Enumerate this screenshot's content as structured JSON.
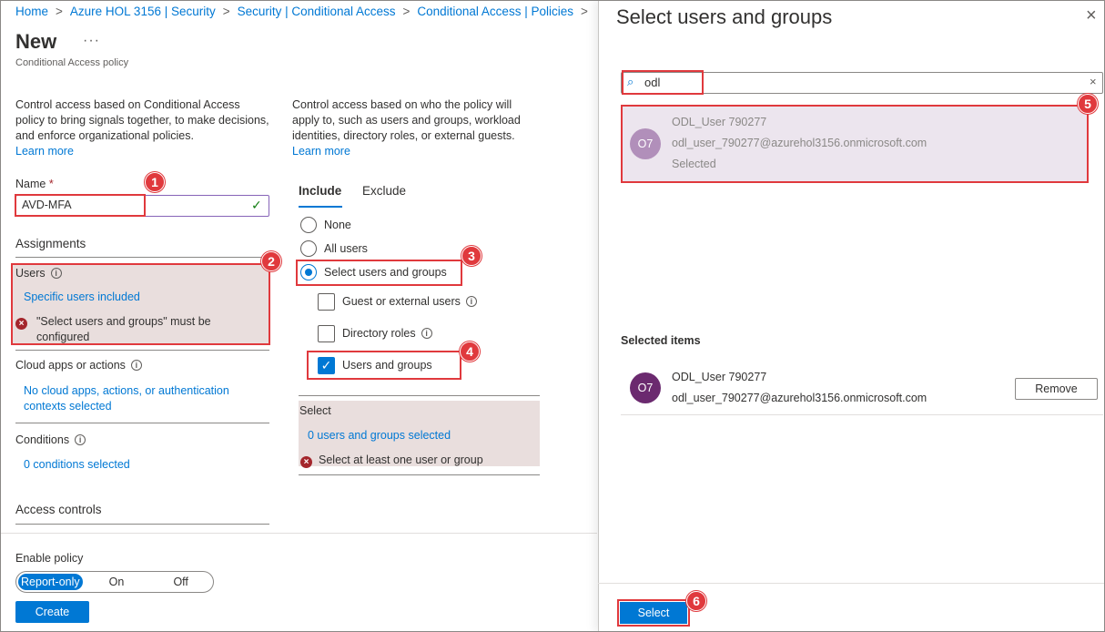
{
  "breadcrumb": [
    "Home",
    "Azure HOL 3156 | Security",
    "Security | Conditional Access",
    "Conditional Access | Policies"
  ],
  "page": {
    "title": "New",
    "more": "···",
    "subtitle": "Conditional Access policy"
  },
  "left_desc": {
    "text": "Control access based on Conditional Access policy to bring signals together, to make decisions, and enforce organizational policies.",
    "learn_more": "Learn more"
  },
  "name_field": {
    "label": "Name",
    "required_mark": "*",
    "value": "AVD-MFA"
  },
  "assignments": {
    "heading": "Assignments",
    "users": {
      "label": "Users",
      "value": "Specific users included",
      "error": "\"Select users and groups\" must be configured"
    },
    "cloud_apps": {
      "label": "Cloud apps or actions",
      "value": "No cloud apps, actions, or authentication contexts selected"
    },
    "conditions": {
      "label": "Conditions",
      "value": "0 conditions selected"
    }
  },
  "access_controls": {
    "heading": "Access controls"
  },
  "enable_policy": {
    "label": "Enable policy",
    "options": [
      "Report-only",
      "On",
      "Off"
    ],
    "selected": "Report-only"
  },
  "create_label": "Create",
  "mid_desc": {
    "text": "Control access based on who the policy will apply to, such as users and groups, workload identities, directory roles, or external guests.",
    "learn_more": "Learn more"
  },
  "tabs": [
    "Include",
    "Exclude"
  ],
  "include_options": {
    "none": "None",
    "all_users": "All users",
    "select_users": "Select users and groups",
    "guest": "Guest or external users",
    "directory_roles": "Directory roles",
    "users_groups": "Users and groups"
  },
  "select_block": {
    "label": "Select",
    "value": "0 users and groups selected",
    "error": "Select at least one user or group"
  },
  "panel": {
    "title": "Select users and groups",
    "search_value": "odl",
    "result": {
      "name": "ODL_User 790277",
      "email": "odl_user_790277@azurehol3156.onmicrosoft.com",
      "status": "Selected",
      "initials": "O7"
    },
    "selected_items_label": "Selected items",
    "selected": {
      "name": "ODL_User 790277",
      "email": "odl_user_790277@azurehol3156.onmicrosoft.com",
      "initials": "O7"
    },
    "remove_label": "Remove",
    "select_label": "Select"
  },
  "annotations": [
    "1",
    "2",
    "3",
    "4",
    "5",
    "6"
  ],
  "colors": {
    "accent": "#0078d4",
    "annotation_red": "#e0393d",
    "error_red": "#a4262c",
    "highlight_bg": "#e9dedd"
  }
}
